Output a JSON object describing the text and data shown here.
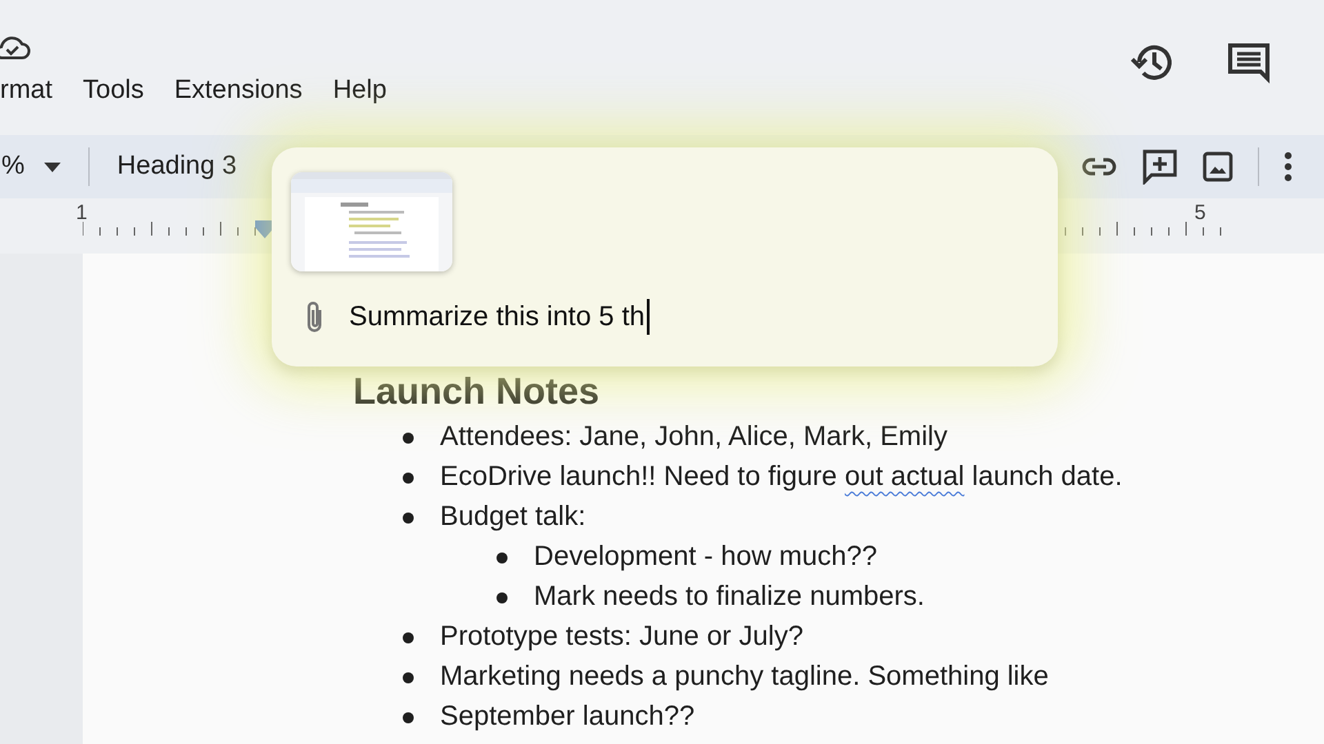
{
  "menu": [
    "rmat",
    "Tools",
    "Extensions",
    "Help"
  ],
  "toolbar": {
    "zoom": "%",
    "style": "Heading 3"
  },
  "ruler": {
    "labels": [
      "1",
      "5"
    ]
  },
  "prompt_popup": {
    "value": "Summarize this into 5 th"
  },
  "document": {
    "heading": "Launch Notes",
    "items": [
      {
        "segments": [
          {
            "text": "Attendees: Jane, John, Alice, Mark, Emily"
          }
        ]
      },
      {
        "segments": [
          {
            "text": "EcoDrive launch!! Need to figure "
          },
          {
            "text": "out actual",
            "flagged": true
          },
          {
            "text": " launch date."
          }
        ]
      },
      {
        "segments": [
          {
            "text": "Budget talk:"
          }
        ],
        "children": [
          {
            "segments": [
              {
                "text": "Development - how much??"
              }
            ]
          },
          {
            "segments": [
              {
                "text": "Mark needs to finalize numbers."
              }
            ]
          }
        ]
      },
      {
        "segments": [
          {
            "text": "Prototype tests: June or July?"
          }
        ]
      },
      {
        "segments": [
          {
            "text": "Marketing needs a punchy tagline. Something like"
          }
        ]
      },
      {
        "segments": [
          {
            "text": "September launch??"
          }
        ]
      }
    ]
  }
}
